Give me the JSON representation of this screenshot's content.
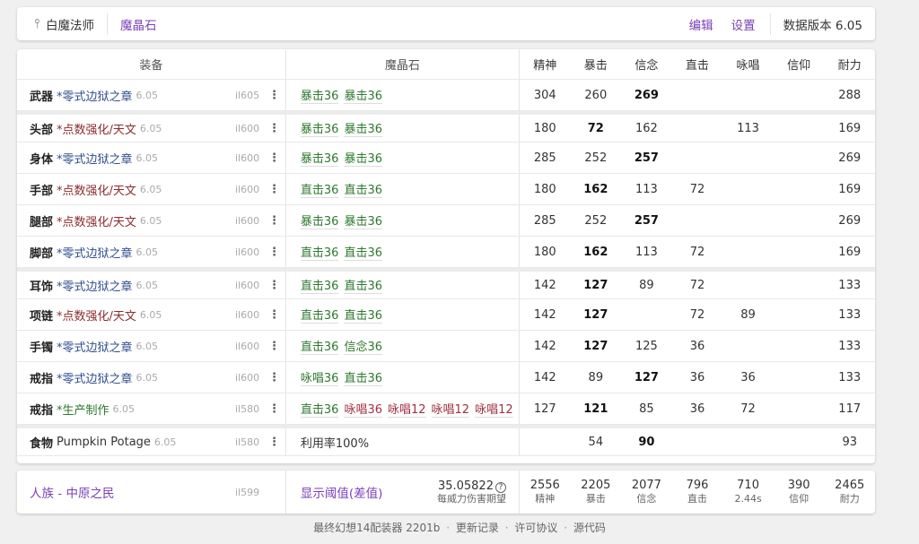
{
  "header": {
    "job": "白魔法师",
    "tab": "魔晶石",
    "edit": "编辑",
    "settings": "设置",
    "version": "数据版本 6.05"
  },
  "columns": {
    "equip": "装备",
    "materia": "魔晶石",
    "stats": [
      "精神",
      "暴击",
      "信念",
      "直击",
      "咏唱",
      "信仰",
      "耐力"
    ]
  },
  "rows": [
    {
      "slot": "武器",
      "name": "*零式边狱之章",
      "ver": "6.05",
      "il": "il605",
      "materia": [
        "暴击36",
        "暴击36"
      ],
      "stats": [
        "304",
        "260",
        "269",
        "",
        "",
        "",
        "288"
      ]
    },
    {
      "slot": "头部",
      "name": "*点数强化/天文",
      "ver": "6.05",
      "il": "il600",
      "materia": [
        "暴击36",
        "暴击36"
      ],
      "stats": [
        "180",
        "72",
        "162",
        "",
        "113",
        "",
        "169"
      ]
    },
    {
      "slot": "身体",
      "name": "*零式边狱之章",
      "ver": "6.05",
      "il": "il600",
      "materia": [
        "暴击36",
        "暴击36"
      ],
      "stats": [
        "285",
        "252",
        "257",
        "",
        "",
        "",
        "269"
      ]
    },
    {
      "slot": "手部",
      "name": "*点数强化/天文",
      "ver": "6.05",
      "il": "il600",
      "materia": [
        "直击36",
        "直击36"
      ],
      "stats": [
        "180",
        "162",
        "113",
        "72",
        "",
        "",
        "169"
      ]
    },
    {
      "slot": "腿部",
      "name": "*点数强化/天文",
      "ver": "6.05",
      "il": "il600",
      "materia": [
        "暴击36",
        "暴击36"
      ],
      "stats": [
        "285",
        "252",
        "257",
        "",
        "",
        "",
        "269"
      ]
    },
    {
      "slot": "脚部",
      "name": "*零式边狱之章",
      "ver": "6.05",
      "il": "il600",
      "materia": [
        "直击36",
        "直击36"
      ],
      "stats": [
        "180",
        "162",
        "113",
        "72",
        "",
        "",
        "169"
      ]
    },
    {
      "slot": "耳饰",
      "name": "*零式边狱之章",
      "ver": "6.05",
      "il": "il600",
      "materia": [
        "直击36",
        "直击36"
      ],
      "stats": [
        "142",
        "127",
        "89",
        "72",
        "",
        "",
        "133"
      ]
    },
    {
      "slot": "项链",
      "name": "*点数强化/天文",
      "ver": "6.05",
      "il": "il600",
      "materia": [
        "直击36",
        "直击36"
      ],
      "stats": [
        "142",
        "127",
        "",
        "72",
        "89",
        "",
        "133"
      ]
    },
    {
      "slot": "手镯",
      "name": "*零式边狱之章",
      "ver": "6.05",
      "il": "il600",
      "materia": [
        "直击36",
        "信念36"
      ],
      "stats": [
        "142",
        "127",
        "125",
        "36",
        "",
        "",
        "133"
      ]
    },
    {
      "slot": "戒指",
      "name": "*零式边狱之章",
      "ver": "6.05",
      "il": "il600",
      "materia": [
        "咏唱36",
        "直击36"
      ],
      "stats": [
        "142",
        "89",
        "127",
        "36",
        "36",
        "",
        "133"
      ]
    },
    {
      "slot": "戒指",
      "name": "*生产制作",
      "ver": "6.05",
      "il": "il580",
      "materia": [
        "直击36",
        "咏唱36",
        "咏唱12",
        "咏唱12",
        "咏唱12"
      ],
      "stats": [
        "127",
        "121",
        "85",
        "36",
        "72",
        "",
        "117"
      ]
    },
    {
      "slot": "食物",
      "name": "Pumpkin Potage",
      "ver": "6.05",
      "il": "il580",
      "materia": [
        "利用率100%"
      ],
      "stats": [
        "",
        "54",
        "90",
        "",
        "",
        "",
        "93"
      ]
    }
  ],
  "summary": {
    "race": "人族 - 中原之民",
    "il": "il599",
    "threshold": "显示阈值(差值)",
    "damage_value": "35.05822",
    "help": "?",
    "damage_label": "每威力伤害期望",
    "stats": [
      {
        "v": "2556",
        "l": "精神"
      },
      {
        "v": "2205",
        "l": "暴击"
      },
      {
        "v": "2077",
        "l": "信念"
      },
      {
        "v": "796",
        "l": "直击"
      },
      {
        "v": "710",
        "l": "2.44s"
      },
      {
        "v": "390",
        "l": "信仰"
      },
      {
        "v": "2465",
        "l": "耐力"
      }
    ]
  },
  "footer": {
    "app": "最终幻想14配装器 2201b",
    "changelog": "更新记录",
    "license": "许可协议",
    "source": "源代码",
    "sep": "·"
  },
  "colors": {
    "accent": "#7a3fb8",
    "savage": "#2f4f8f",
    "tome": "#8b2b2b",
    "craft": "#2d7a2d",
    "materia_green": "#2d7a2d",
    "materia_red": "#a03040"
  }
}
